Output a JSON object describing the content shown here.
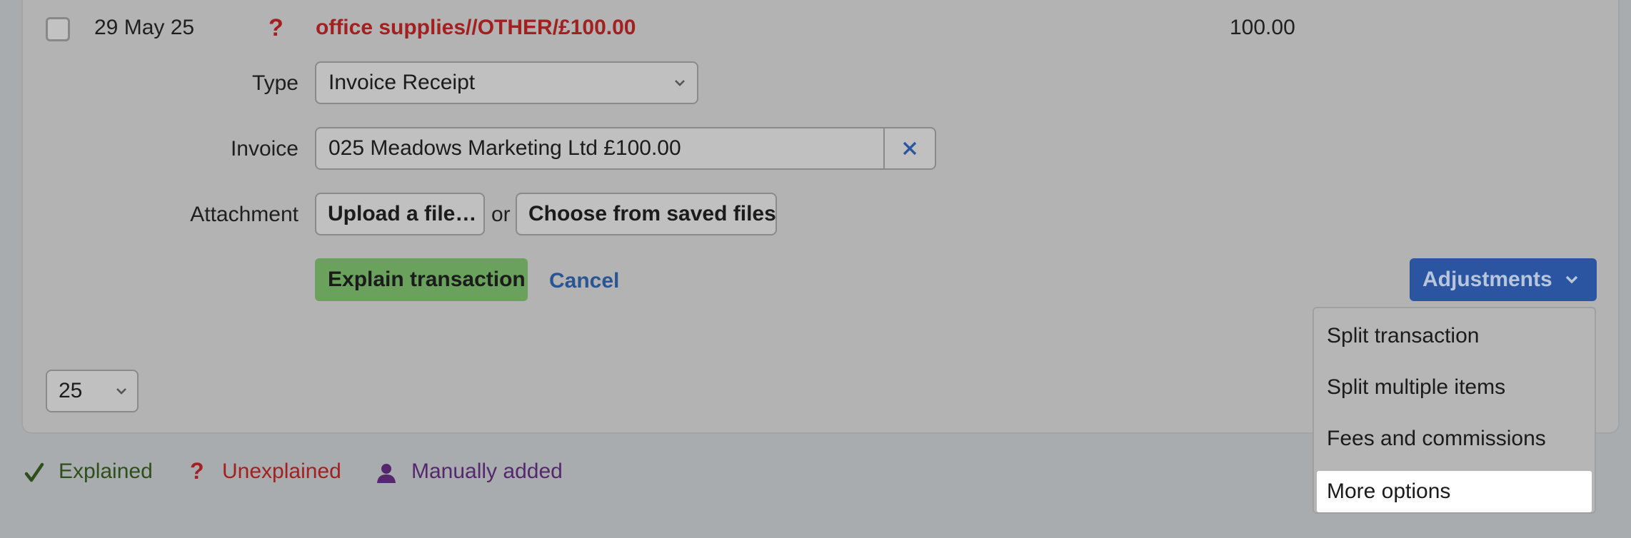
{
  "transaction": {
    "date": "29 May 25",
    "status_mark": "?",
    "description": "office supplies//OTHER/£100.00",
    "amount": "100.00"
  },
  "form": {
    "type_label": "Type",
    "type_value": "Invoice Receipt",
    "invoice_label": "Invoice",
    "invoice_value": "025 Meadows Marketing Ltd £100.00",
    "attachment_label": "Attachment",
    "upload_label": "Upload a file…",
    "or_text": "or",
    "choose_label": "Choose from saved files",
    "explain_label": "Explain transaction",
    "cancel_label": "Cancel",
    "adjustments_label": "Adjustments"
  },
  "adjustments_menu": {
    "items": [
      "Split transaction",
      "Split multiple items",
      "Fees and commissions",
      "More options"
    ]
  },
  "pagination": {
    "per_page": "25"
  },
  "legend": {
    "explained": "Explained",
    "unexplained": "Unexplained",
    "unexplained_mark": "?",
    "manual": "Manually added"
  },
  "icons": [
    "checkmark-icon",
    "question-icon",
    "person-icon",
    "close-icon",
    "chevron-down-icon"
  ],
  "colors": {
    "accent_blue": "#2b55a0",
    "success_green": "#6aa15c",
    "error_red": "#a32020",
    "manual_purple": "#55286e"
  }
}
